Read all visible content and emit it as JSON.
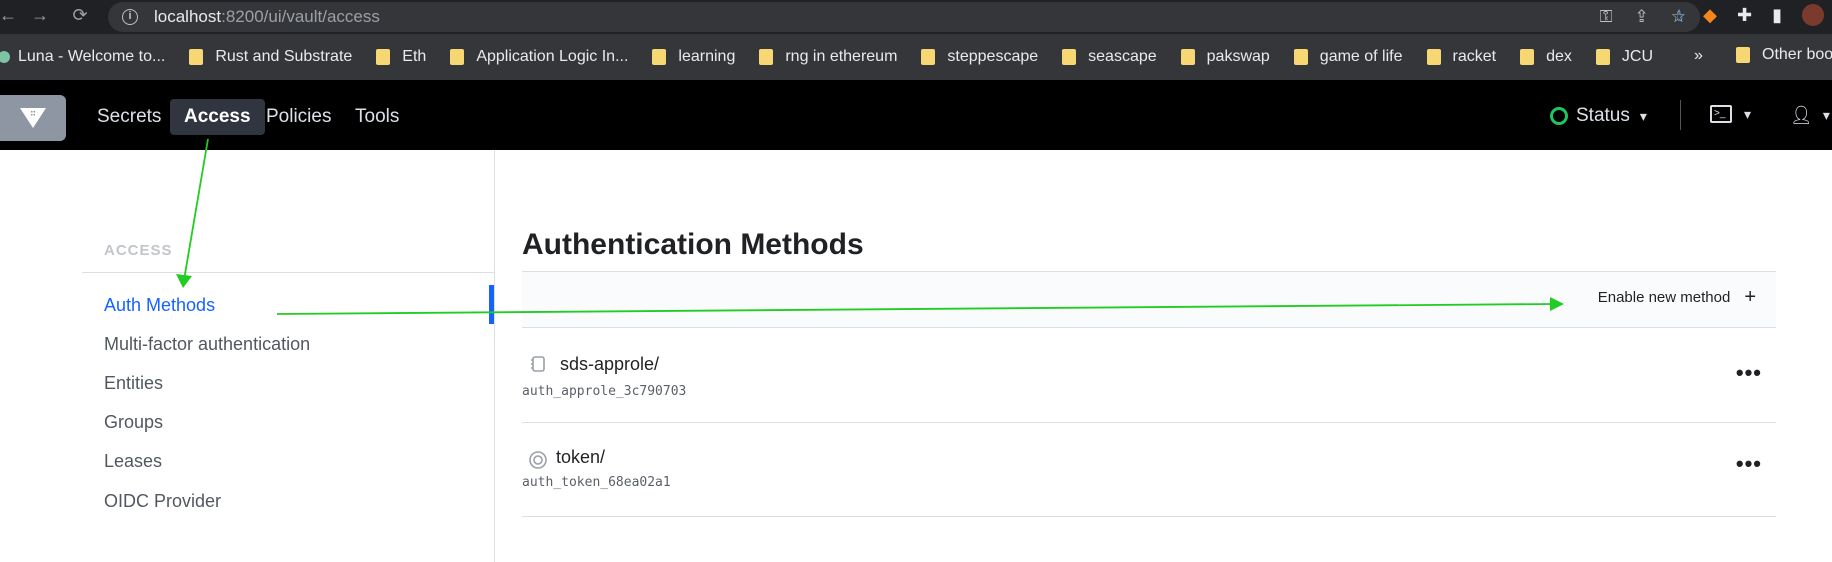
{
  "browser": {
    "url_host": "localhost",
    "url_path": ":8200/ui/vault/access",
    "bookmarks": [
      "Luna - Welcome to...",
      "Rust and Substrate",
      "Eth",
      "Application Logic In...",
      "learning",
      "rng in ethereum",
      "steppescape",
      "seascape",
      "pakswap",
      "game of life",
      "racket",
      "dex",
      "JCU"
    ],
    "more": "»",
    "other_bookmarks": "Other boo"
  },
  "nav": {
    "items": [
      "Secrets",
      "Access",
      "Policies",
      "Tools"
    ],
    "status_label": "Status"
  },
  "sidebar": {
    "title": "ACCESS",
    "items": [
      "Auth Methods",
      "Multi-factor authentication",
      "Entities",
      "Groups",
      "Leases",
      "OIDC Provider"
    ]
  },
  "main": {
    "title": "Authentication Methods",
    "enable_label": "Enable new method",
    "enable_icon": "+",
    "methods": [
      {
        "path": "sds-approle/",
        "accessor": "auth_approle_3c790703",
        "icon": "approle-icon"
      },
      {
        "path": "token/",
        "accessor": "auth_token_68ea02a1",
        "icon": "token-icon"
      }
    ],
    "more_label": "•••"
  },
  "colors": {
    "accent": "#1563ff",
    "annotation": "#22cc22",
    "status_ok": "#21c55d"
  }
}
